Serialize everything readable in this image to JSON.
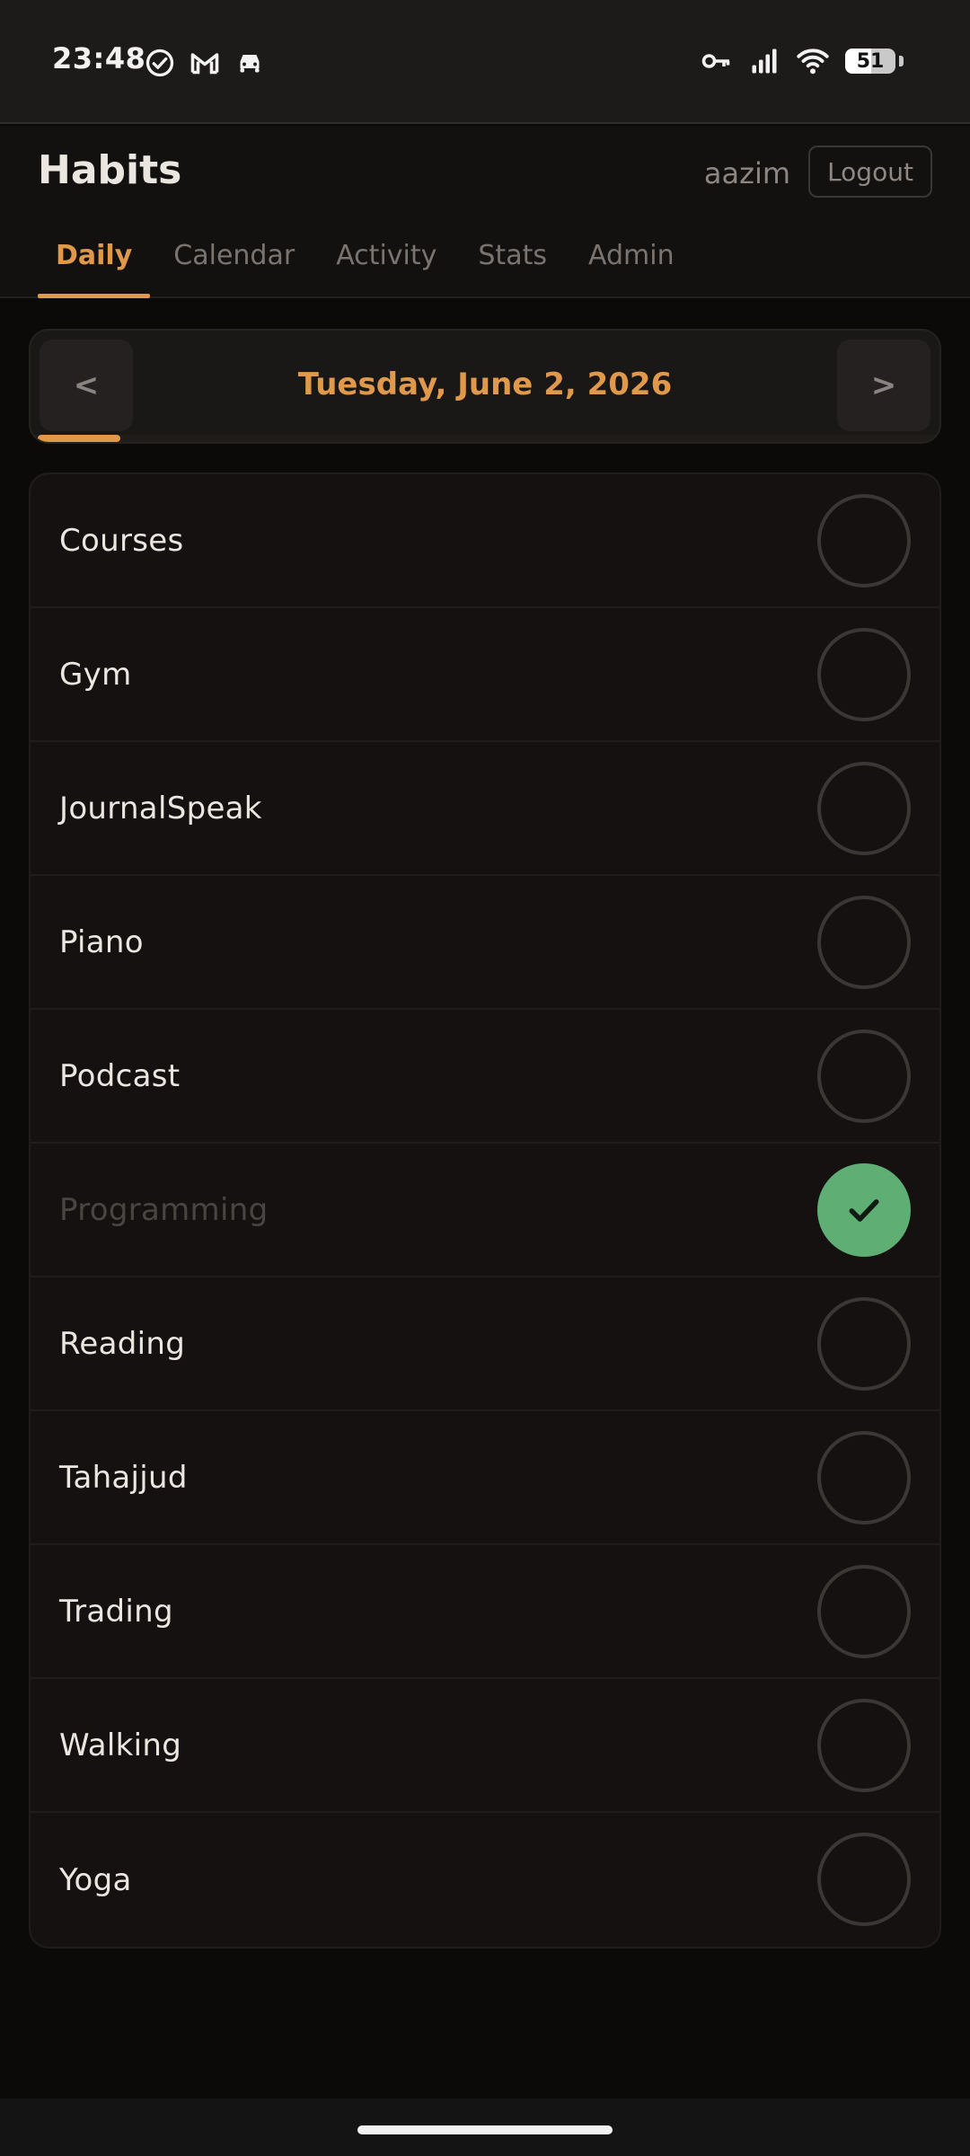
{
  "status_bar": {
    "time": "23:48",
    "left_icons": [
      "check-circle-icon",
      "gmail-icon",
      "car-icon"
    ],
    "right_icons": [
      "key-icon",
      "signal-icon",
      "wifi-icon"
    ],
    "battery_level": "51",
    "battery_fraction": 0.51
  },
  "header": {
    "title": "Habits",
    "username": "aazim",
    "logout_label": "Logout"
  },
  "tabs": [
    {
      "label": "Daily",
      "active": true
    },
    {
      "label": "Calendar",
      "active": false
    },
    {
      "label": "Activity",
      "active": false
    },
    {
      "label": "Stats",
      "active": false
    },
    {
      "label": "Admin",
      "active": false
    }
  ],
  "date_nav": {
    "prev_label": "<",
    "next_label": ">",
    "date": "Tuesday, June 2, 2026",
    "progress_fraction": 0.0909
  },
  "habits": [
    {
      "name": "Courses",
      "done": false
    },
    {
      "name": "Gym",
      "done": false
    },
    {
      "name": "JournalSpeak",
      "done": false
    },
    {
      "name": "Piano",
      "done": false
    },
    {
      "name": "Podcast",
      "done": false
    },
    {
      "name": "Programming",
      "done": true
    },
    {
      "name": "Reading",
      "done": false
    },
    {
      "name": "Tahajjud",
      "done": false
    },
    {
      "name": "Trading",
      "done": false
    },
    {
      "name": "Walking",
      "done": false
    },
    {
      "name": "Yoga",
      "done": false
    }
  ],
  "colors": {
    "accent": "#e0984a",
    "done": "#5fae74",
    "background": "#0b0a09"
  }
}
